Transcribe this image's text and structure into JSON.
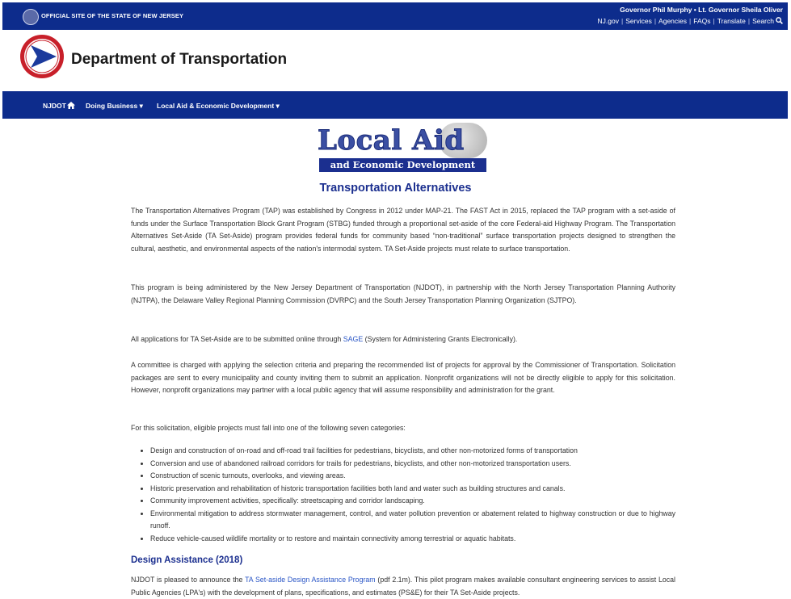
{
  "topbar": {
    "official_label": "OFFICIAL SITE OF THE STATE OF NEW JERSEY",
    "governor": "Governor Phil Murphy • Lt. Governor Sheila Oliver",
    "links": [
      "NJ.gov",
      "Services",
      "Agencies",
      "FAQs",
      "Translate",
      "Search"
    ]
  },
  "brand": {
    "title": "Department of Transportation"
  },
  "nav": {
    "home": "NJDOT",
    "doing_business": "Doing Business",
    "local_aid": "Local Aid & Economic Development"
  },
  "banner": {
    "line1": "Local Aid",
    "line2": "and Economic Development"
  },
  "page_title": "Transportation Alternatives",
  "paragraphs": {
    "p1": "The Transportation Alternatives Program (TAP) was established by Congress in 2012 under MAP-21. The FAST Act in 2015, replaced the TAP program with a set-aside of funds under the Surface Transportation Block Grant Program (STBG) funded through a proportional set-aside of the core Federal-aid Highway Program. The Transportation Alternatives Set-Aside (TA Set-Aside) program provides federal funds for community based “non-traditional” surface transportation projects designed to strengthen the cultural, aesthetic, and environmental aspects of the nation's intermodal system. TA Set-Aside projects must relate to surface transportation.",
    "p2": "This program is being administered by the New Jersey Department of Transportation (NJDOT), in partnership with the North Jersey Transportation Planning Authority (NJTPA), the Delaware Valley Regional Planning Commission (DVRPC) and the South Jersey Transportation Planning Organization (SJTPO).",
    "p3_pre": "All applications for TA Set-Aside are to be submitted online through ",
    "p3_link": "SAGE",
    "p3_post": " (System for Administering Grants Electronically).",
    "p4": "A committee is charged with applying the selection criteria and preparing the recommended list of projects for approval by the Commissioner of Transportation. Solicitation packages are sent to every municipality and county inviting them to submit an application. Nonprofit organizations will not be directly eligible to apply for this solicitation. However, nonprofit organizations may partner with a local public agency that will assume responsibility and administration for the grant.",
    "p5": "For this solicitation, eligible projects must fall into one of the following seven categories:"
  },
  "categories": [
    "Design and construction of on-road and off-road trail facilities for pedestrians, bicyclists, and other non-motorized forms of transportation",
    "Conversion and use of abandoned railroad corridors for trails for pedestrians, bicyclists, and other non-motorized transportation users.",
    "Construction of scenic turnouts, overlooks, and viewing areas.",
    "Historic preservation and rehabilitation of historic transportation facilities both land and water such as building structures and canals.",
    "Community improvement activities, specifically: streetscaping and corridor landscaping.",
    "Environmental mitigation to address stormwater management, control, and water pollution prevention or abatement related to highway construction or due to highway runoff.",
    "Reduce vehicle-caused wildlife mortality or to restore and maintain connectivity among terrestrial or aquatic habitats."
  ],
  "design_assistance": {
    "heading": "Design Assistance (2018)",
    "pre": "NJDOT is pleased to announce the ",
    "link": "TA Set-aside Design Assistance Program",
    "post": " (pdf 2.1m). This pilot program makes available consultant engineering services to assist Local Public Agencies (LPA's) with the development of plans, specifications, and estimates (PS&E) for their TA Set-Aside projects."
  },
  "colors": {
    "header_bg": "#0d2c8c",
    "heading_blue": "#1b2f8f",
    "link_blue": "#2a56c6"
  },
  "icons": {
    "home": "home-icon",
    "search": "search-icon",
    "caret": "caret-down-icon"
  }
}
